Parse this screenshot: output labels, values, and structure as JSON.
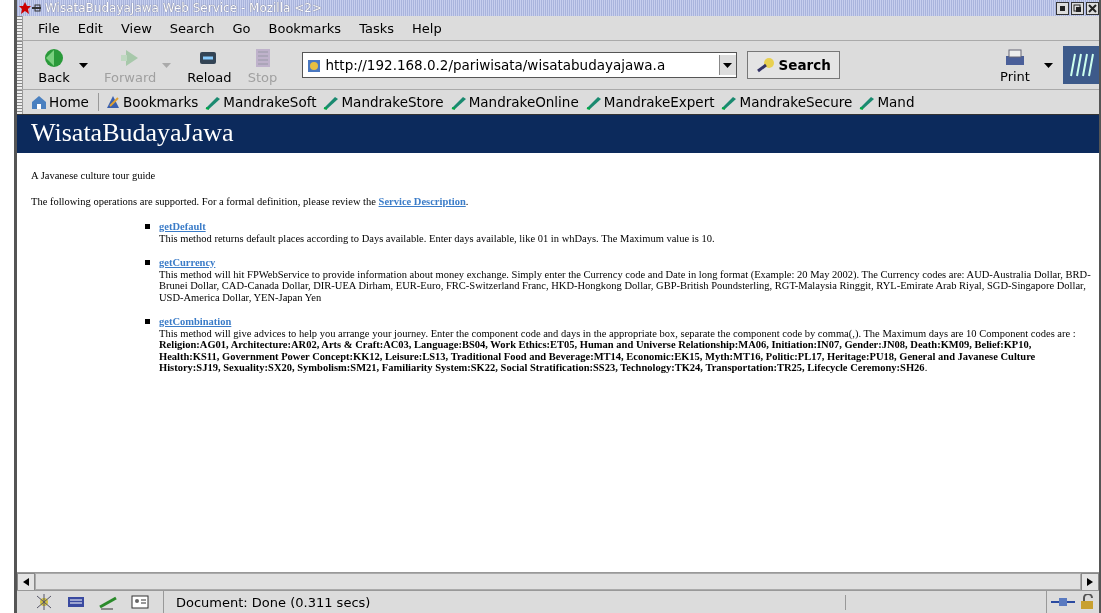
{
  "window": {
    "title": "WisataBudayaJawa Web Service - Mozilla <2>"
  },
  "menu": [
    "File",
    "Edit",
    "View",
    "Search",
    "Go",
    "Bookmarks",
    "Tasks",
    "Help"
  ],
  "toolbar": {
    "nav_buttons": [
      {
        "label": "Back",
        "kind": "back",
        "disabled": false,
        "dropdown": true
      },
      {
        "label": "Forward",
        "kind": "forward",
        "disabled": true,
        "dropdown": true
      },
      {
        "label": "Reload",
        "kind": "reload",
        "disabled": false,
        "dropdown": false
      },
      {
        "label": "Stop",
        "kind": "stop",
        "disabled": true,
        "dropdown": false
      }
    ],
    "address": "http://192.168.0.2/pariwisata/wisatabudayajawa.a",
    "search_button": "Search",
    "print_button": "Print"
  },
  "bookmarks": [
    {
      "label": "Home",
      "kind": "home"
    },
    {
      "label": "Bookmarks",
      "kind": "folder"
    },
    {
      "label": "MandrakeSoft",
      "kind": "link"
    },
    {
      "label": "MandrakeStore",
      "kind": "link"
    },
    {
      "label": "MandrakeOnline",
      "kind": "link"
    },
    {
      "label": "MandrakeExpert",
      "kind": "link"
    },
    {
      "label": "MandrakeSecure",
      "kind": "link"
    },
    {
      "label": "Mand",
      "kind": "link"
    }
  ],
  "page": {
    "heading": "WisataBudayaJawa",
    "tagline": "A Javanese culture tour guide",
    "intro": "The following operations are supported. For a formal definition, please review the ",
    "intro_link": "Service Description",
    "intro_end": ".",
    "operations": [
      {
        "name": "getDefault",
        "description": "This method returns default places according to Days available. Enter days available, like 01 in whDays. The Maximum value is 10."
      },
      {
        "name": "getCurrency",
        "description": "This method will hit FPWebService to provide information about money exchange. Simply enter the Currency code and Date in long format (Example: 20 May 2002). The Currency codes are: AUD-Australia Dollar, BRD-Brunei Dollar, CAD-Canada Dollar, DIR-UEA Dirham, EUR-Euro, FRC-Switzerland Franc, HKD-Hongkong Dollar, GBP-British Poundsterling, RGT-Malaysia Ringgit, RYL-Emirate Arab Riyal, SGD-Singapore Dollar, USD-America Dollar, YEN-Japan Yen"
      },
      {
        "name": "getCombination",
        "description": "This method will give advices to help you arrange your journey. Enter the component code and days in the appropriate box, separate the component code by comma(,). The Maximum days are 10 Component codes are : **Religion:AG01, Architecture:AR02, Arts & Craft:AC03, Language:BS04, Work Ethics:ET05, Human and Universe Relationship:MA06, Initiation:IN07, Gender:JN08, Death:KM09, Belief:KP10, Health:KS11, Government Power Concept:KK12, Leisure:LS13, Traditional Food and Beverage:MT14, Economic:EK15, Myth:MT16, Politic:PL17, Heritage:PU18, General and Javanese Culture History:SJ19, Sexuality:SX20, Symbolism:SM21, Familiarity System:SK22, Social Stratification:SS23, Technology:TK24, Transportation:TR25, Lifecycle Ceremony:SH26**."
      }
    ]
  },
  "status_bar": {
    "text": "Document: Done (0.311 secs)"
  }
}
